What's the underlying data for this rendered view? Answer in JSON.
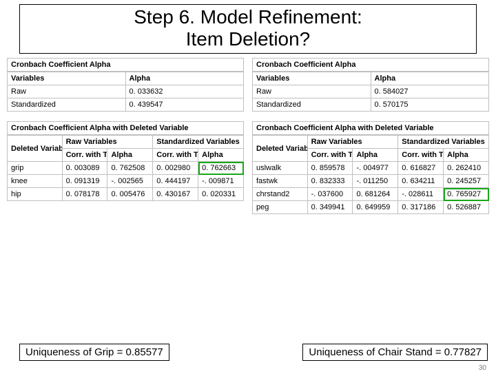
{
  "title_l1": "Step 6. Model Refinement:",
  "title_l2": "Item Deletion?",
  "labels": {
    "section_alpha": "Cronbach Coefficient Alpha",
    "variables": "Variables",
    "alpha": "Alpha",
    "raw": "Raw",
    "standardized": "Standardized",
    "section_del": "Cronbach Coefficient Alpha with Deleted Variable",
    "deleted_var": "Deleted Variable",
    "raw_vars": "Raw Variables",
    "std_vars": "Standardized Variables",
    "corr": "Corr. with Total"
  },
  "left": {
    "alpha_raw": "0. 033632",
    "alpha_std": "0. 439547",
    "rows": [
      {
        "name": "grip",
        "rc": "0. 003089",
        "ra": "0. 762508",
        "sc": "0. 002980",
        "sa": "0. 762663"
      },
      {
        "name": "knee",
        "rc": "0. 091319",
        "ra": "-. 002565",
        "sc": "0. 444197",
        "sa": "-. 009871"
      },
      {
        "name": "hip",
        "rc": "0. 078178",
        "ra": "0. 005476",
        "sc": "0. 430167",
        "sa": "0. 020331"
      }
    ],
    "note": "Uniqueness of Grip = 0.85577"
  },
  "right": {
    "alpha_raw": "0. 584027",
    "alpha_std": "0. 570175",
    "rows": [
      {
        "name": "uslwalk",
        "rc": "0. 859578",
        "ra": "-. 004977",
        "sc": "0. 616827",
        "sa": "0. 262410"
      },
      {
        "name": "fastwk",
        "rc": "0. 832333",
        "ra": "-. 011250",
        "sc": "0. 634211",
        "sa": "0. 245257"
      },
      {
        "name": "chrstand2",
        "rc": "-. 037600",
        "ra": "0. 681264",
        "sc": "-. 028611",
        "sa": "0. 765927"
      },
      {
        "name": "peg",
        "rc": "0. 349941",
        "ra": "0. 649959",
        "sc": "0. 317186",
        "sa": "0. 526887"
      }
    ],
    "note": "Uniqueness of Chair Stand = 0.77827"
  },
  "page": "30"
}
